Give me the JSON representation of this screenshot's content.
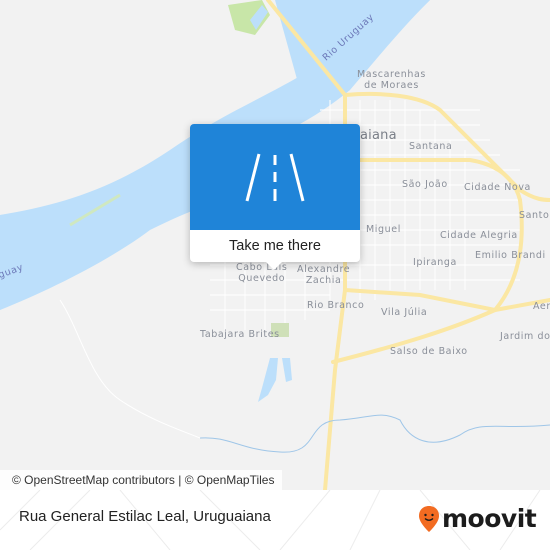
{
  "map": {
    "colors": {
      "land": "#f2f2f2",
      "water": "#bcdffb",
      "major_road": "#fbe7a3",
      "park": "#c8e6a8",
      "accent": "#1f84d8",
      "brand": "#f26b21"
    },
    "labels": {
      "rio_uruguay": "Rio Uruguay",
      "uruguay_left": "guay",
      "mascarenhas_1": "Mascarenhas",
      "mascarenhas_2": "de Moraes",
      "city": "aiana",
      "santana": "Santana",
      "sao_joao": "São João",
      "cidade_nova": "Cidade Nova",
      "santo": "Santo",
      "miguel": "Miguel",
      "cidade_alegria": "Cidade Alegria",
      "emilio_brandi": "Emilio Brandi",
      "ipiranga": "Ipiranga",
      "cabo_1": "Cabo Luis",
      "cabo_2": "Quevedo",
      "alexandre_1": "Alexandre",
      "alexandre_2": "Zachia",
      "rio_branco": "Rio Branco",
      "vila_julia": "Vila Júlia",
      "aer": "Aer",
      "tabajara": "Tabajara Brites",
      "jardim": "Jardim do",
      "salso": "Salso de Baixo"
    }
  },
  "popup": {
    "icon": "road-icon",
    "button_label": "Take me there"
  },
  "attribution": "© OpenStreetMap contributors | © OpenMapTiles",
  "footer": {
    "location_title": "Rua General Estilac Leal, Uruguaiana",
    "brand_name": "moovit",
    "brand_icon": "moovit-pin-icon"
  }
}
